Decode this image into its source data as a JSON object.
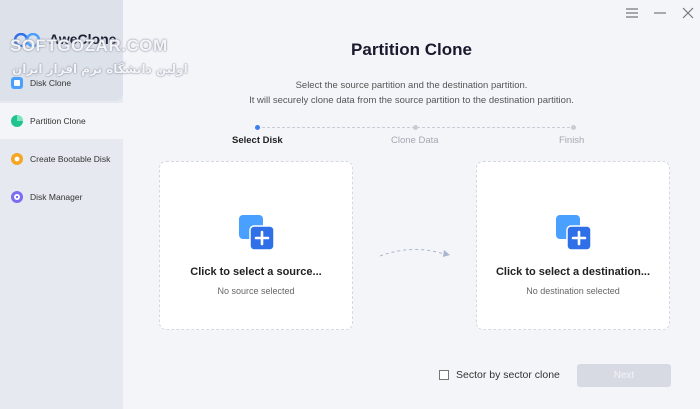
{
  "app": {
    "name": "AweClone",
    "watermark": "SOFTGOZAR.COM",
    "watermark_sub": "اولین دانشگاه نرم افزار ایران"
  },
  "sidebar": {
    "items": [
      {
        "label": "Disk Clone",
        "icon": "disk-clone-icon",
        "active": false
      },
      {
        "label": "Partition Clone",
        "icon": "partition-clone-icon",
        "active": true
      },
      {
        "label": "Create Bootable Disk",
        "icon": "bootable-disk-icon",
        "active": false
      },
      {
        "label": "Disk Manager",
        "icon": "disk-manager-icon",
        "active": false
      }
    ]
  },
  "main": {
    "title": "Partition Clone",
    "description_line1": "Select the source partition and the destination partition.",
    "description_line2": "It will securely clone data from the source partition to the destination partition.",
    "steps": [
      {
        "label": "Select Disk",
        "active": true
      },
      {
        "label": "Clone Data",
        "active": false
      },
      {
        "label": "Finish",
        "active": false
      }
    ],
    "source_card": {
      "title": "Click to select a source...",
      "subtitle": "No source selected"
    },
    "destination_card": {
      "title": "Click to select a destination...",
      "subtitle": "No destination selected"
    },
    "sector_checkbox_label": "Sector by sector clone",
    "next_label": "Next"
  },
  "colors": {
    "accent": "#3d7ef0",
    "sidebar_bg": "#e6e9f0",
    "content_bg": "#f4f5f8",
    "next_disabled": "#d7dae3"
  }
}
